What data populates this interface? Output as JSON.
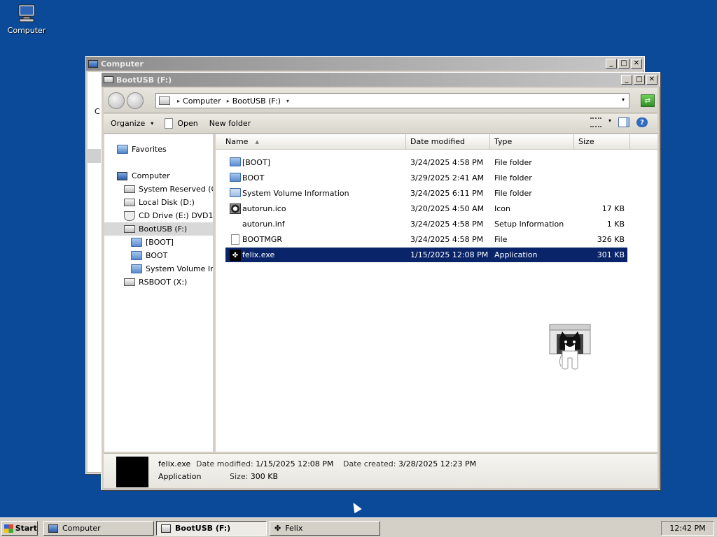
{
  "desktop": {
    "computer_label": "Computer"
  },
  "back_window": {
    "title": "Computer",
    "partial_letter": "C"
  },
  "front_window": {
    "title": "BootUSB (F:)",
    "caption_buttons": {
      "minimize": "_",
      "maximize": "□",
      "close": "✕"
    },
    "address": {
      "crumbs": [
        "Computer",
        "BootUSB (F:)"
      ],
      "separator": "▸",
      "dropdown": "▾"
    },
    "commands": {
      "organize": "Organize",
      "open": "Open",
      "new_folder": "New folder"
    },
    "nav": [
      {
        "label": "Favorites",
        "icon": "favorites-folder-icon"
      },
      {
        "label": "Computer",
        "icon": "computer-icon"
      },
      {
        "label": "System Reserved (C:)",
        "icon": "drive-icon"
      },
      {
        "label": "Local Disk (D:)",
        "icon": "drive-icon"
      },
      {
        "label": "CD Drive (E:) DVD1",
        "icon": "cd-drive-icon"
      },
      {
        "label": "BootUSB (F:)",
        "icon": "drive-icon"
      },
      {
        "label": "[BOOT]",
        "icon": "folder-icon"
      },
      {
        "label": "BOOT",
        "icon": "folder-icon"
      },
      {
        "label": "System Volume Information",
        "icon": "folder-icon"
      },
      {
        "label": "RSBOOT (X:)",
        "icon": "drive-icon"
      }
    ],
    "columns": {
      "name": "Name",
      "date": "Date modified",
      "type": "Type",
      "size": "Size"
    },
    "files": [
      {
        "name": "[BOOT]",
        "date": "3/24/2025 4:58 PM",
        "type": "File folder",
        "size": "",
        "icon": "folder-icon"
      },
      {
        "name": "BOOT",
        "date": "3/29/2025 2:41 AM",
        "type": "File folder",
        "size": "",
        "icon": "folder-icon"
      },
      {
        "name": "System Volume Information",
        "date": "3/24/2025 6:11 PM",
        "type": "File folder",
        "size": "",
        "icon": "folder-icon"
      },
      {
        "name": "autorun.ico",
        "date": "3/20/2025 4:50 AM",
        "type": "Icon",
        "size": "17 KB",
        "icon": "ico-file-icon"
      },
      {
        "name": "autorun.inf",
        "date": "3/24/2025 4:58 PM",
        "type": "Setup Information",
        "size": "1 KB",
        "icon": "inf-file-icon"
      },
      {
        "name": "BOOTMGR",
        "date": "3/24/2025 4:58 PM",
        "type": "File",
        "size": "326 KB",
        "icon": "file-icon"
      },
      {
        "name": "felix.exe",
        "date": "1/15/2025 12:08 PM",
        "type": "Application",
        "size": "301 KB",
        "icon": "paw-app-icon",
        "selected": true
      }
    ],
    "details": {
      "name": "felix.exe",
      "type": "Application",
      "date_modified_label": "Date modified:",
      "date_modified": "1/15/2025 12:08 PM",
      "date_created_label": "Date created:",
      "date_created": "3/28/2025 12:23 PM",
      "size_label": "Size:",
      "size": "300 KB"
    }
  },
  "taskbar": {
    "start": "Start",
    "tasks": [
      "Computer",
      "BootUSB (F:)",
      "Felix"
    ],
    "clock": "12:42 PM"
  },
  "colors": {
    "desktop": "#0b4a98",
    "title_active": "#0a246a",
    "selection": "#0a246a"
  }
}
